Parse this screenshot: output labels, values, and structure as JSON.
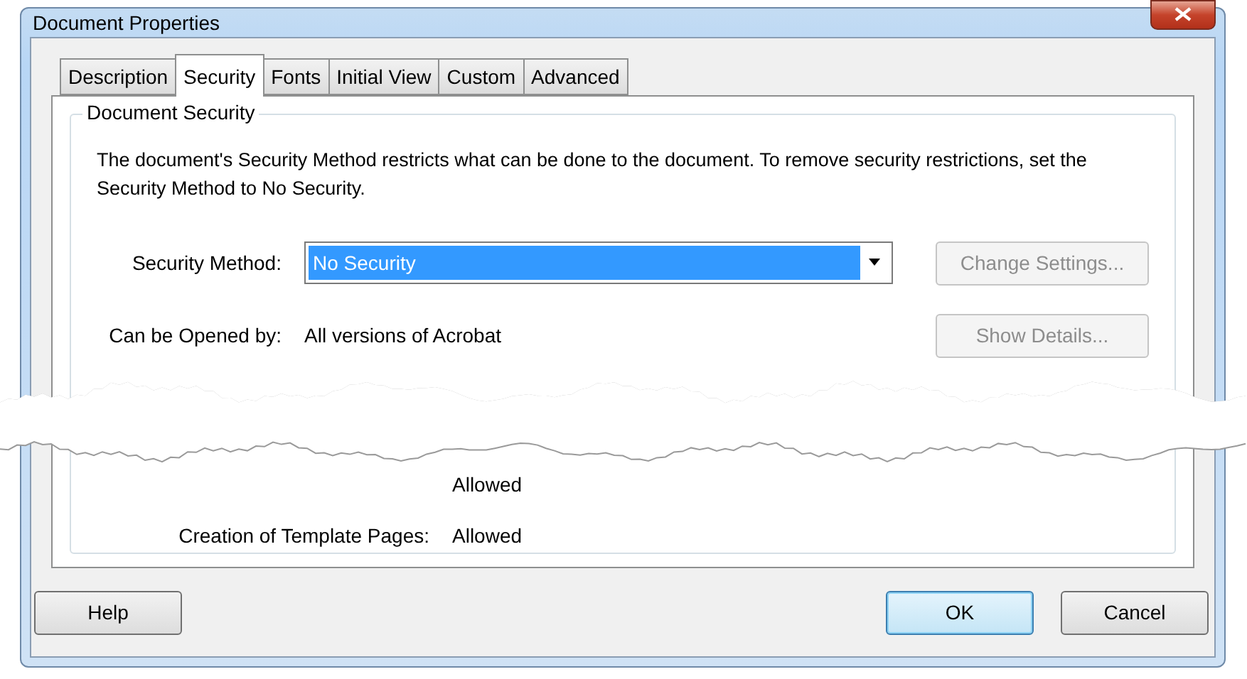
{
  "window": {
    "title": "Document Properties"
  },
  "tabs": [
    {
      "label": "Description",
      "selected": false
    },
    {
      "label": "Security",
      "selected": true
    },
    {
      "label": "Fonts",
      "selected": false
    },
    {
      "label": "Initial View",
      "selected": false
    },
    {
      "label": "Custom",
      "selected": false
    },
    {
      "label": "Advanced",
      "selected": false
    }
  ],
  "group": {
    "title": "Document Security",
    "description": "The document's Security Method restricts what can be done to the document. To remove security restrictions, set the Security Method to No Security.",
    "security_method": {
      "label": "Security Method:",
      "value": "No Security"
    },
    "change_settings": {
      "label": "Change Settings...",
      "disabled": true
    },
    "opened_by": {
      "label": "Can be Opened by:",
      "value": "All versions of Acrobat"
    },
    "show_details": {
      "label": "Show Details...",
      "disabled": true
    },
    "permissions": [
      {
        "value": "Allowed"
      },
      {
        "label": "Creation of Template Pages:",
        "value": "Allowed"
      }
    ]
  },
  "buttons": [
    {
      "label": "Help",
      "default": false
    },
    {
      "label": "OK",
      "default": true
    },
    {
      "label": "Cancel",
      "default": false
    }
  ]
}
